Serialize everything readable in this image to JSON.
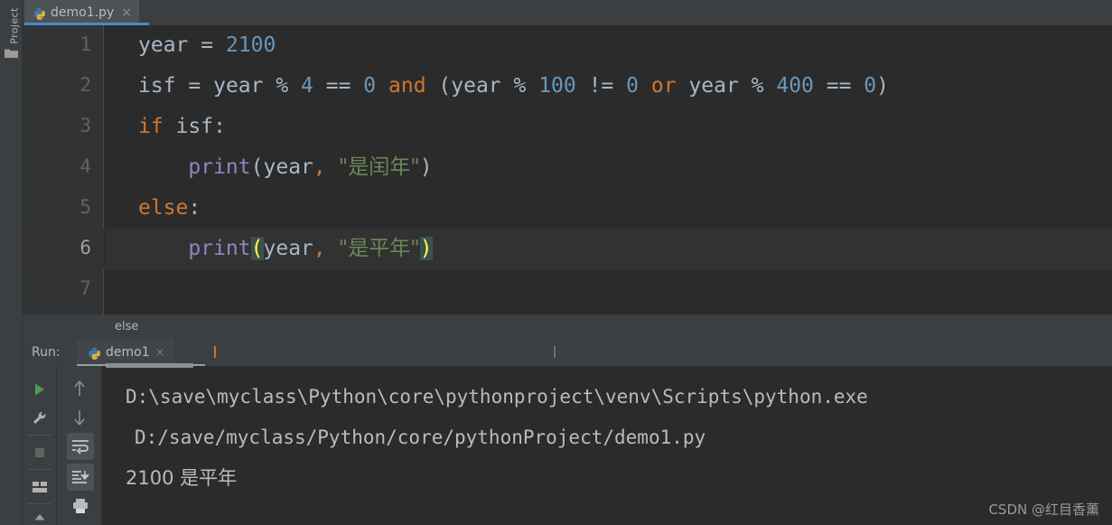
{
  "window": {
    "sidebar_label": "Project"
  },
  "tab": {
    "title": "demo1.py",
    "close": "×",
    "icon": "python-file-icon"
  },
  "editor": {
    "line_numbers": [
      "1",
      "2",
      "3",
      "4",
      "5",
      "6",
      "7"
    ],
    "current_line": 6,
    "lines": [
      {
        "n": 1,
        "tokens": [
          {
            "t": "year",
            "c": "id"
          },
          {
            "t": " ",
            "c": "op"
          },
          {
            "t": "=",
            "c": "op"
          },
          {
            "t": " ",
            "c": "op"
          },
          {
            "t": "2100",
            "c": "num"
          }
        ]
      },
      {
        "n": 2,
        "tokens": [
          {
            "t": "isf",
            "c": "id"
          },
          {
            "t": " = ",
            "c": "op"
          },
          {
            "t": "year",
            "c": "id"
          },
          {
            "t": " % ",
            "c": "op"
          },
          {
            "t": "4",
            "c": "num"
          },
          {
            "t": " == ",
            "c": "op"
          },
          {
            "t": "0",
            "c": "num"
          },
          {
            "t": " ",
            "c": "op"
          },
          {
            "t": "and",
            "c": "kw"
          },
          {
            "t": " (",
            "c": "op"
          },
          {
            "t": "year",
            "c": "id"
          },
          {
            "t": " % ",
            "c": "op"
          },
          {
            "t": "100",
            "c": "num"
          },
          {
            "t": " != ",
            "c": "op"
          },
          {
            "t": "0",
            "c": "num"
          },
          {
            "t": " ",
            "c": "op"
          },
          {
            "t": "or",
            "c": "kw"
          },
          {
            "t": " ",
            "c": "op"
          },
          {
            "t": "year",
            "c": "id"
          },
          {
            "t": " % ",
            "c": "op"
          },
          {
            "t": "400",
            "c": "num"
          },
          {
            "t": " == ",
            "c": "op"
          },
          {
            "t": "0",
            "c": "num"
          },
          {
            "t": ")",
            "c": "op"
          }
        ]
      },
      {
        "n": 3,
        "tokens": [
          {
            "t": "if",
            "c": "kw"
          },
          {
            "t": " ",
            "c": "op"
          },
          {
            "t": "isf",
            "c": "id"
          },
          {
            "t": ":",
            "c": "op"
          }
        ]
      },
      {
        "n": 4,
        "tokens": [
          {
            "t": "    ",
            "c": "op"
          },
          {
            "t": "print",
            "c": "fn"
          },
          {
            "t": "(",
            "c": "op"
          },
          {
            "t": "year",
            "c": "id"
          },
          {
            "t": ",",
            "c": "comma"
          },
          {
            "t": " ",
            "c": "op"
          },
          {
            "t": "\"是闰年\"",
            "c": "str"
          },
          {
            "t": ")",
            "c": "op"
          }
        ]
      },
      {
        "n": 5,
        "tokens": [
          {
            "t": "else",
            "c": "kw"
          },
          {
            "t": ":",
            "c": "op"
          }
        ]
      },
      {
        "n": 6,
        "tokens": [
          {
            "t": "    ",
            "c": "op"
          },
          {
            "t": "print",
            "c": "fn"
          },
          {
            "t": "(",
            "c": "brkhl"
          },
          {
            "t": "year",
            "c": "id"
          },
          {
            "t": ",",
            "c": "comma"
          },
          {
            "t": " ",
            "c": "op"
          },
          {
            "t": "\"是平年\"",
            "c": "str"
          },
          {
            "t": ")",
            "c": "brkhl"
          }
        ]
      },
      {
        "n": 7,
        "tokens": []
      }
    ]
  },
  "breadcrumb": {
    "text": "else"
  },
  "run_panel": {
    "label": "Run:",
    "tab_name": "demo1",
    "tab_close": "×",
    "toolbar_left": [
      {
        "name": "rerun-button",
        "icon": "play-icon"
      },
      {
        "name": "debug-settings-button",
        "icon": "wrench-icon"
      },
      {
        "name": "stop-button",
        "icon": "stop-square-icon"
      },
      {
        "name": "layout-button",
        "icon": "layout-icon"
      },
      {
        "name": "pin-button",
        "icon": "chevron-up-icon"
      }
    ],
    "toolbar_right": [
      {
        "name": "up-stack-button",
        "icon": "arrow-up-icon"
      },
      {
        "name": "down-stack-button",
        "icon": "arrow-down-icon"
      },
      {
        "name": "soft-wrap-button",
        "icon": "soft-wrap-icon"
      },
      {
        "name": "scroll-to-end-button",
        "icon": "scroll-to-end-icon"
      },
      {
        "name": "print-button",
        "icon": "printer-icon"
      }
    ]
  },
  "console": {
    "lines": [
      "D:\\save\\myclass\\Python\\core\\pythonproject\\venv\\Scripts\\python.exe",
      "D:/save/myclass/Python/core/pythonProject/demo1.py",
      "2100 是平年"
    ]
  },
  "watermark": {
    "text": "CSDN @红目香薰"
  },
  "colors": {
    "editor_bg": "#2b2b2b",
    "panel_bg": "#3c3f41",
    "gutter_bg": "#313335",
    "keyword": "#cc7832",
    "number": "#6897bb",
    "string": "#6a8759",
    "function": "#8888c6",
    "identifier": "#a9b7c6",
    "tab_accent": "#4a88c7",
    "bracket_match_fg": "#ffff45",
    "bracket_match_bg": "#3b514d",
    "run_green": "#499c54"
  }
}
